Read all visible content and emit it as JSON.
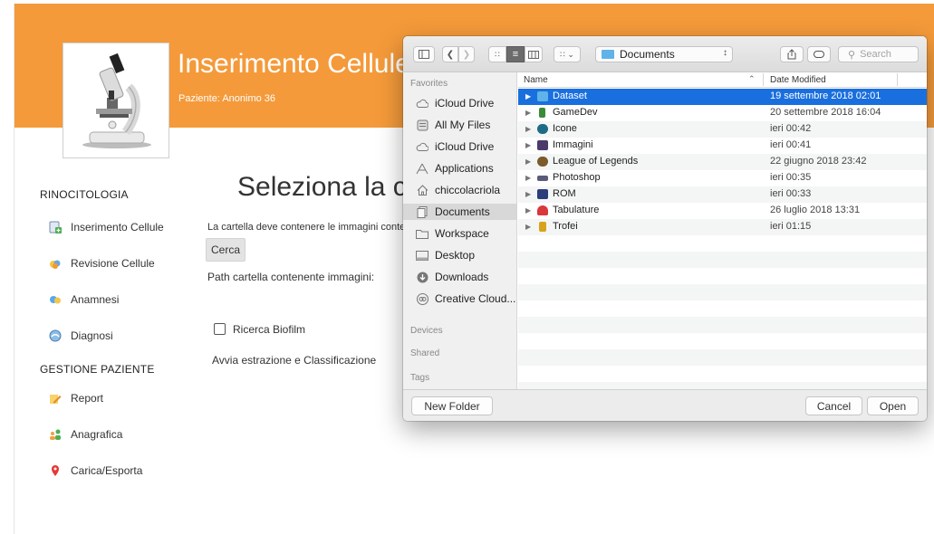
{
  "app": {
    "title": "Inserimento Cellule",
    "patient": "Paziente: Anonimo 36",
    "heading": "Seleziona la c",
    "description": "La cartella deve contenere le immagini conte",
    "search_button": "Cerca",
    "path_label": "Path cartella contenente immagini:",
    "biofilm_label": "Ricerca Biofilm",
    "biofilm_checked": false,
    "start_label": "Avvia estrazione e Classificazione"
  },
  "sidebar": {
    "sections": [
      {
        "title": "RINOCITOLOGIA",
        "items": [
          {
            "label": "Inserimento Cellule",
            "icon": "insert-doc-icon"
          },
          {
            "label": "Revisione Cellule",
            "icon": "cells-icon"
          },
          {
            "label": "Anamnesi",
            "icon": "anamnesi-icon"
          },
          {
            "label": "Diagnosi",
            "icon": "diagnosis-icon"
          }
        ]
      },
      {
        "title": "GESTIONE PAZIENTE",
        "items": [
          {
            "label": "Report",
            "icon": "pencil-icon"
          },
          {
            "label": "Anagrafica",
            "icon": "people-icon"
          },
          {
            "label": "Carica/Esporta",
            "icon": "map-pin-icon"
          }
        ]
      }
    ]
  },
  "dialog": {
    "location": "Documents",
    "search_placeholder": "Search",
    "favorites_title": "Favorites",
    "favorites": [
      {
        "label": "iCloud Drive",
        "icon": "cloud-icon"
      },
      {
        "label": "All My Files",
        "icon": "all-files-icon"
      },
      {
        "label": "iCloud Drive",
        "icon": "cloud-icon"
      },
      {
        "label": "Applications",
        "icon": "applications-icon"
      },
      {
        "label": "chiccolacriola",
        "icon": "home-icon"
      },
      {
        "label": "Documents",
        "icon": "documents-icon",
        "selected": true
      },
      {
        "label": "Workspace",
        "icon": "folder-icon"
      },
      {
        "label": "Desktop",
        "icon": "desktop-icon"
      },
      {
        "label": "Downloads",
        "icon": "downloads-icon"
      },
      {
        "label": "Creative Cloud...",
        "icon": "creative-cloud-icon"
      }
    ],
    "devices_title": "Devices",
    "shared_title": "Shared",
    "tags_title": "Tags",
    "columns": {
      "name": "Name",
      "date": "Date Modified"
    },
    "files": [
      {
        "name": "Dataset",
        "date": "19 settembre 2018 02:01",
        "selected": true,
        "color": "#5fb3e8"
      },
      {
        "name": "GameDev",
        "date": "20 settembre 2018 16:04",
        "color": "#3b8a3a"
      },
      {
        "name": "Icone",
        "date": "ieri 00:42",
        "color": "#1e6b87"
      },
      {
        "name": "Immagini",
        "date": "ieri 00:41",
        "color": "#4a3b6b"
      },
      {
        "name": "League of Legends",
        "date": "22 giugno 2018 23:42",
        "color": "#7a5b2a"
      },
      {
        "name": "Photoshop",
        "date": "ieri 00:35",
        "color": "#5a5a7a"
      },
      {
        "name": "ROM",
        "date": "ieri 00:33",
        "color": "#2b3d7a"
      },
      {
        "name": "Tabulature",
        "date": "26 luglio 2018 13:31",
        "color": "#d8373b"
      },
      {
        "name": "Trofei",
        "date": "ieri 01:15",
        "color": "#d9a21b"
      }
    ],
    "new_folder": "New Folder",
    "cancel": "Cancel",
    "open": "Open"
  },
  "colors": {
    "banner": "#f49a3a",
    "selection": "#1a6fde"
  }
}
